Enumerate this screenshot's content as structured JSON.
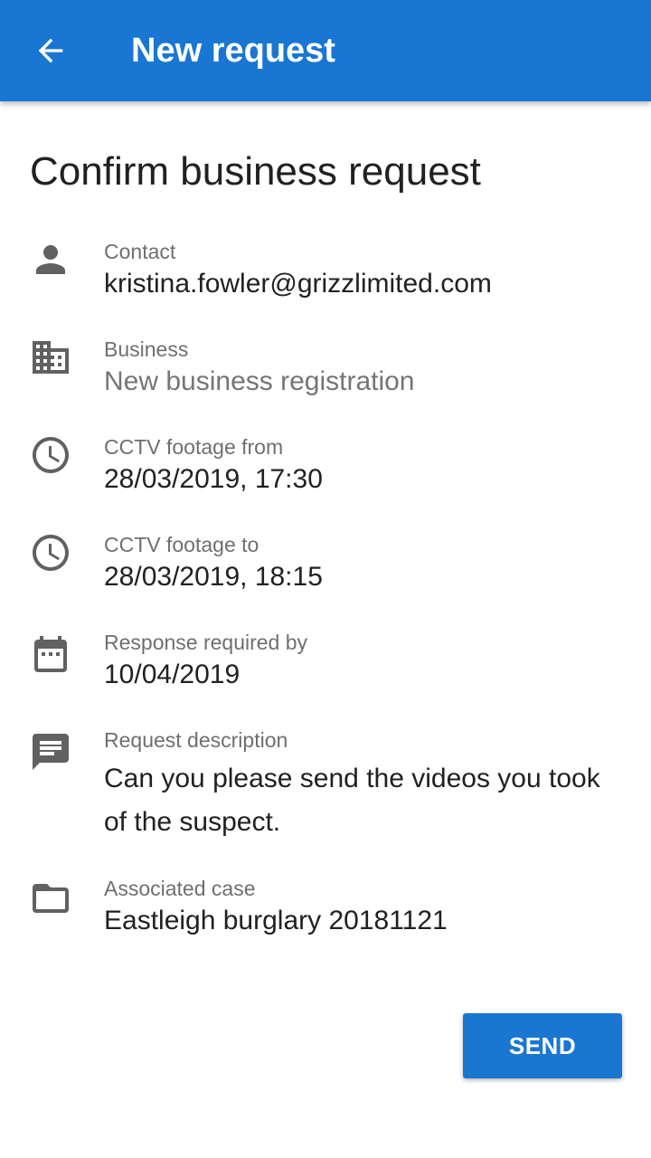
{
  "app_bar": {
    "title": "New request",
    "back_icon": "arrow-left-icon",
    "background_color": "#1976d2"
  },
  "heading": "Confirm business request",
  "fields": [
    {
      "icon": "person-icon",
      "label": "Contact",
      "value": "kristina.fowler@grizzlimited.com"
    },
    {
      "icon": "building-icon",
      "label": "Business",
      "value": "New business registration"
    },
    {
      "icon": "clock-icon",
      "label": "CCTV footage from",
      "value": "28/03/2019, 17:30"
    },
    {
      "icon": "clock-icon",
      "label": "CCTV footage to",
      "value": "28/03/2019, 18:15"
    },
    {
      "icon": "calendar-icon",
      "label": "Response required by",
      "value": "10/04/2019"
    },
    {
      "icon": "message-icon",
      "label": "Request description",
      "value": "Can you please send the videos you took of the suspect."
    },
    {
      "icon": "folder-icon",
      "label": "Associated case",
      "value": "Eastleigh burglary 20181121"
    }
  ],
  "actions": {
    "send_label": "SEND",
    "accent_color": "#1976d2"
  }
}
